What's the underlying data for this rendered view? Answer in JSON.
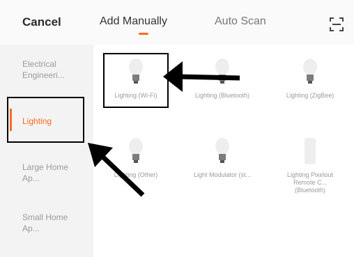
{
  "header": {
    "cancel_label": "Cancel",
    "tabs": [
      {
        "label": "Add Manually",
        "active": true
      },
      {
        "label": "Auto Scan",
        "active": false
      }
    ],
    "scan_icon": "qr-scan-icon"
  },
  "sidebar": {
    "items": [
      {
        "label": "Electrical Engineeri..."
      },
      {
        "label": "Lighting",
        "active": true
      },
      {
        "label": "Large Home Ap..."
      },
      {
        "label": "Small Home Ap..."
      }
    ]
  },
  "devices": [
    {
      "label": "Lighting (Wi-Fi)",
      "icon": "bulb-icon"
    },
    {
      "label": "Lighting (Bluetooth)",
      "icon": "bulb-icon"
    },
    {
      "label": "Lighting (ZigBee)",
      "icon": "bulb-icon"
    },
    {
      "label": "Lighting (Other)",
      "icon": "bulb-icon"
    },
    {
      "label": "Light Modulator (st...",
      "icon": "bulb-icon"
    },
    {
      "label": "Lighting Pixel­out Remote C... (Bluetooth)",
      "icon": "bulb-icon"
    }
  ],
  "colors": {
    "accent": "#ff6a1f",
    "sidebar_bg": "#f3f3f3",
    "annotation": "#000000"
  }
}
